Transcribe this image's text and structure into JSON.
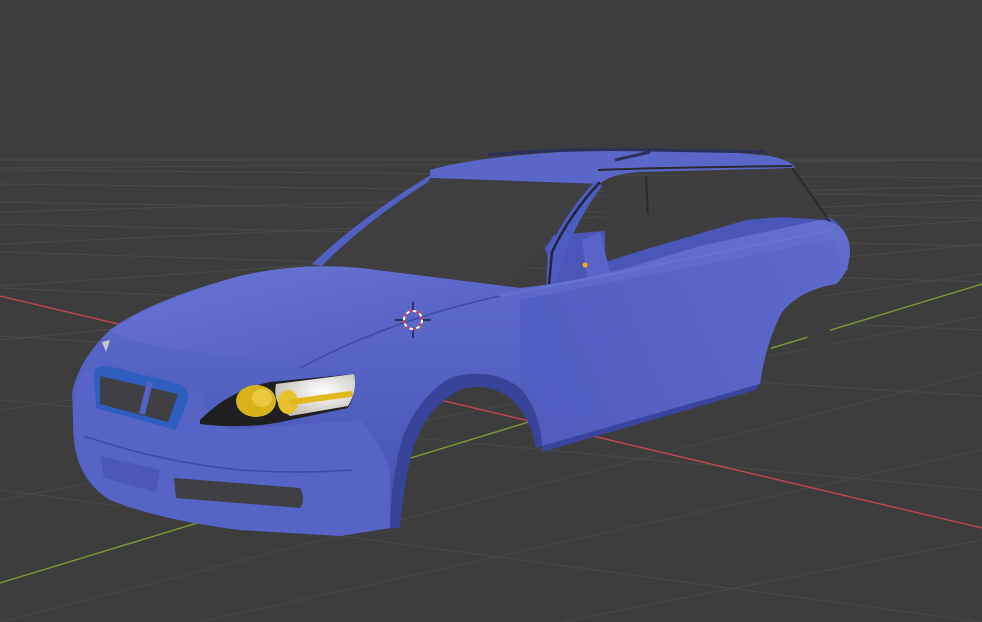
{
  "viewport": {
    "background": "#3d3d3d",
    "grid_color": "#4a4a4a",
    "x_axis_color": "#c2454f",
    "y_axis_color": "#7a9c34"
  },
  "model": {
    "body_color": "#5462c4",
    "body_shadow_color": "#3a44a0",
    "window_color": "#3d3d3d",
    "glass_trim_color": "#2e5fbf",
    "headlight_lens_color": "#ebe9e2",
    "headlight_amber_color": "#d9b21a",
    "origin_dot_color": "#f7a51d"
  },
  "cursor": {
    "icon": "3d-cursor-icon",
    "ring_colors": [
      "#ffffff",
      "#e03b3b"
    ]
  }
}
